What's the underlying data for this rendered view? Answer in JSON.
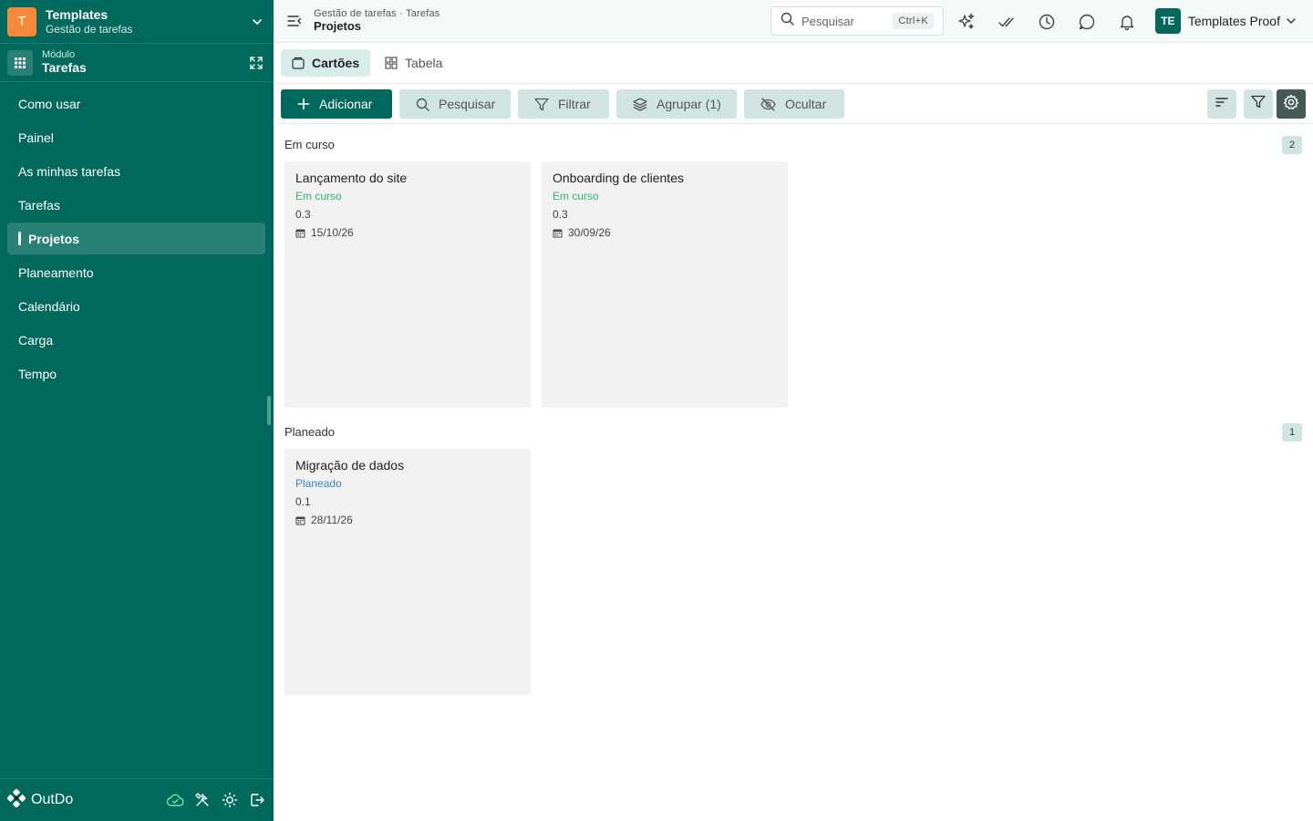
{
  "colors": {
    "brand": "#00695c",
    "workspace_avatar": "#f5893a",
    "status_em_curso": "#2eb872",
    "status_planeado": "#3b82d6"
  },
  "workspace": {
    "initial": "T",
    "name": "Templates",
    "subtitle": "Gestão de tarefas"
  },
  "module": {
    "label": "Módulo",
    "name": "Tarefas"
  },
  "sidebar": {
    "items": [
      {
        "label": "Como usar"
      },
      {
        "label": "Painel"
      },
      {
        "label": "As minhas tarefas"
      },
      {
        "label": "Tarefas"
      },
      {
        "label": "Projetos",
        "active": true
      },
      {
        "label": "Planeamento"
      },
      {
        "label": "Calendário"
      },
      {
        "label": "Carga"
      },
      {
        "label": "Tempo"
      }
    ],
    "brand": "OutDo",
    "tool_icons": [
      "cloud-check-icon",
      "tools-icon",
      "sun-icon",
      "logout-icon"
    ]
  },
  "header": {
    "breadcrumb": "Gestão de tarefas · Tarefas",
    "title": "Projetos",
    "search_placeholder": "Pesquisar",
    "search_shortcut": "Ctrl+K",
    "icons": [
      "sparkles-icon",
      "check-double-icon",
      "clock-icon",
      "chat-icon",
      "bell-icon"
    ],
    "user": {
      "initials": "TE",
      "name": "Templates Proof"
    }
  },
  "views": {
    "tabs": [
      {
        "label": "Cartões",
        "icon": "card-icon",
        "active": true
      },
      {
        "label": "Tabela",
        "icon": "grid-icon",
        "active": false
      }
    ]
  },
  "toolbar": {
    "add_label": "Adicionar",
    "search_label": "Pesquisar",
    "filter_label": "Filtrar",
    "group_label": "Agrupar (1)",
    "hide_label": "Ocultar",
    "right_icons": [
      "sort-icon",
      "filter-icon",
      "settings-icon"
    ]
  },
  "groups": [
    {
      "label": "Em curso",
      "count": "2",
      "cards": [
        {
          "title": "Lançamento do site",
          "status": "Em curso",
          "progress": "0.3",
          "date": "15/10/26"
        },
        {
          "title": "Onboarding de clientes",
          "status": "Em curso",
          "progress": "0.3",
          "date": "30/09/26"
        }
      ]
    },
    {
      "label": "Planeado",
      "count": "1",
      "cards": [
        {
          "title": "Migração de dados",
          "status": "Planeado",
          "progress": "0.1",
          "date": "28/11/26"
        }
      ]
    }
  ]
}
